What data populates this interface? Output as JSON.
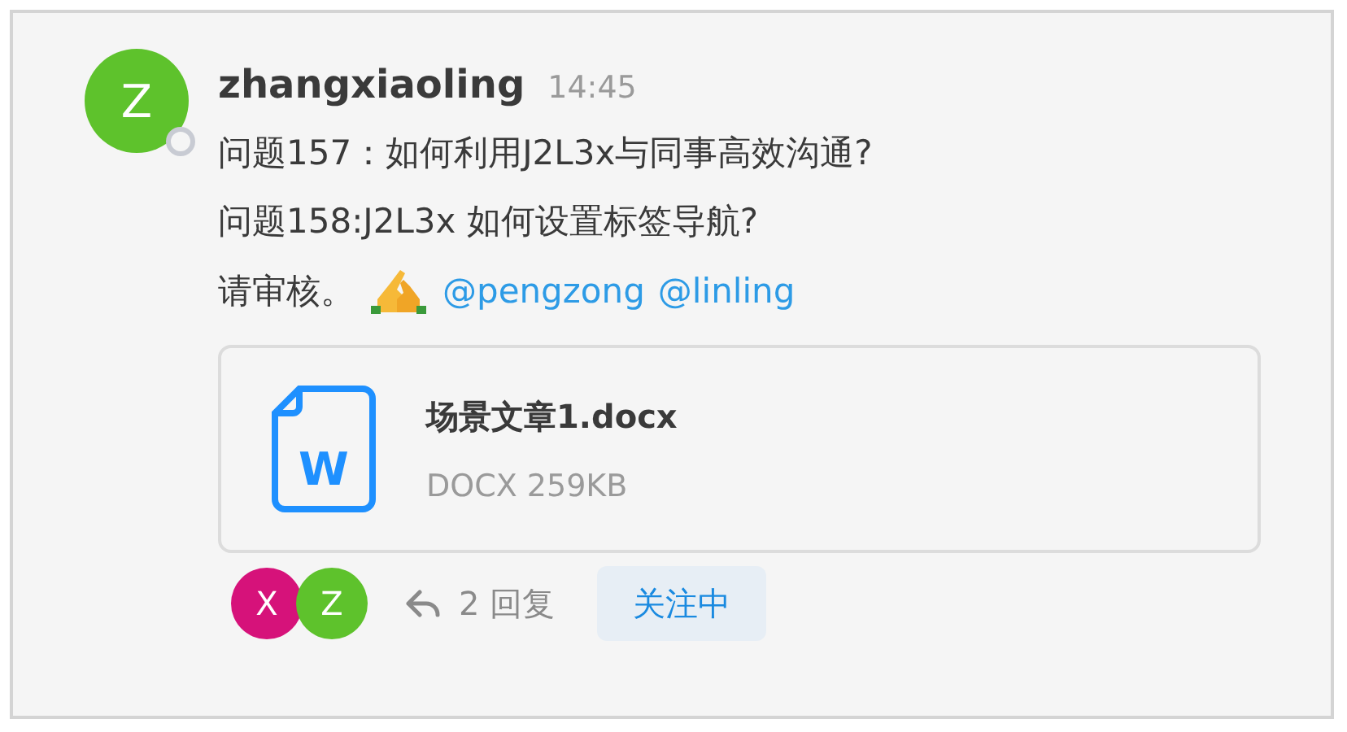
{
  "message": {
    "avatar": {
      "initial": "Z",
      "color": "#5ec22c",
      "online": false
    },
    "author": "zhangxiaoling",
    "time": "14:45",
    "lines": [
      {
        "kind": "text",
        "text": "问题157：如何利用J2L3x与同事高效沟通?"
      },
      {
        "kind": "text",
        "text": "问题158:J2L3x 如何设置标签导航?"
      },
      {
        "kind": "mentions",
        "text": "请审核。",
        "mentions": [
          "@pengzong",
          "@linling"
        ]
      }
    ],
    "attachment": {
      "name": "场景文章1.docx",
      "meta": "DOCX 259KB",
      "badge": "W"
    },
    "thread": {
      "participants": [
        {
          "initial": "X",
          "color": "#d6127a"
        },
        {
          "initial": "Z",
          "color": "#5ec22c"
        }
      ],
      "replies": "2 回复",
      "follow_label": "关注中"
    }
  }
}
